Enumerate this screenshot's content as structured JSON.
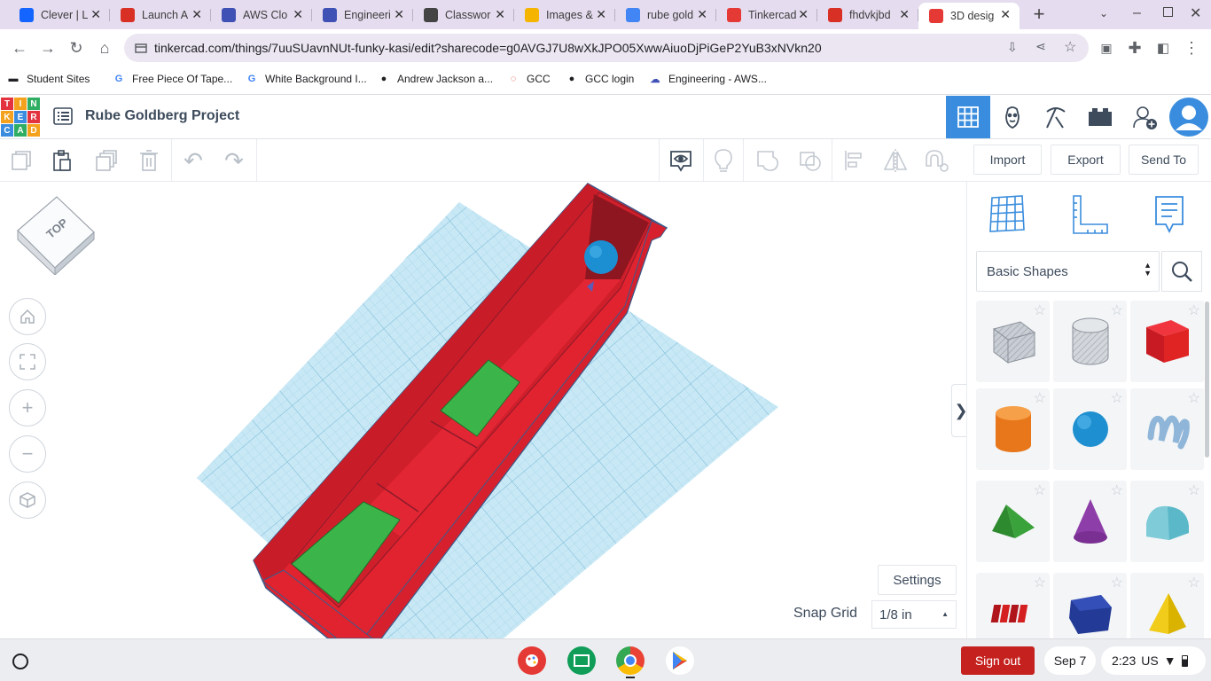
{
  "browser": {
    "tabs": [
      {
        "label": "Clever | L",
        "icon": "clever-icon",
        "color": "#1464ff"
      },
      {
        "label": "Launch A",
        "icon": "launch-icon",
        "color": "#d93025"
      },
      {
        "label": "AWS Clo",
        "icon": "aws-cloud-icon",
        "color": "#3f51b5"
      },
      {
        "label": "Engineeri",
        "icon": "aws-cloud-icon",
        "color": "#3f51b5"
      },
      {
        "label": "Classwor",
        "icon": "classroom-icon",
        "color": "#444"
      },
      {
        "label": "Images &",
        "icon": "slides-icon",
        "color": "#f4b400"
      },
      {
        "label": "rube gold",
        "icon": "google-icon",
        "color": "#4285f4"
      },
      {
        "label": "Tinkercad",
        "icon": "tinkercad-icon",
        "color": "#e53935"
      },
      {
        "label": "fhdvkjbd",
        "icon": "gmail-icon",
        "color": "#d93025"
      },
      {
        "label": "3D desig",
        "icon": "tinkercad-icon",
        "color": "#e53935"
      }
    ],
    "new_tab": "+",
    "url": "tinkercad.com/things/7uuSUavnNUt-funky-kasi/edit?sharecode=g0AVGJ7U8wXkJPO05XwwAiuoDjPiGeP2YuB3xNVkn20",
    "bookmarks": [
      {
        "label": "Student Sites",
        "icon": "folder-icon"
      },
      {
        "label": "Free Piece Of Tape...",
        "icon": "google-icon"
      },
      {
        "label": "White Background I...",
        "icon": "google-icon"
      },
      {
        "label": "Andrew Jackson a...",
        "icon": "globe-icon"
      },
      {
        "label": "GCC",
        "icon": "gcc-icon"
      },
      {
        "label": "GCC login",
        "icon": "globe-icon"
      },
      {
        "label": "Engineering - AWS...",
        "icon": "aws-cloud-icon"
      }
    ]
  },
  "tinkercad": {
    "logo_letters": [
      "T",
      "I",
      "N",
      "K",
      "E",
      "R",
      "C",
      "A",
      "D"
    ],
    "project_title": "Rube Goldberg Project",
    "header_buttons": [
      "3d-view-icon",
      "codeblocks-icon",
      "lesson-icon",
      "bricks-icon",
      "add-user-icon",
      "account-avatar"
    ],
    "actions": {
      "import": "Import",
      "export": "Export",
      "send_to": "Send To"
    },
    "view_cube_label": "TOP",
    "settings_label": "Settings",
    "snap_grid": {
      "label": "Snap Grid",
      "value": "1/8 in"
    },
    "shape_category": "Basic Shapes",
    "shapes": [
      {
        "name": "box-hole",
        "color": "#b9bfc8"
      },
      {
        "name": "cylinder-hole",
        "color": "#c9cdd3"
      },
      {
        "name": "box",
        "color": "#e02323"
      },
      {
        "name": "cylinder",
        "color": "#f0821e"
      },
      {
        "name": "sphere",
        "color": "#1e8fd0"
      },
      {
        "name": "scribble",
        "color": "#8fb6d8"
      },
      {
        "name": "roof",
        "color": "#3aa23a"
      },
      {
        "name": "cone",
        "color": "#8e3ea8"
      },
      {
        "name": "round-roof",
        "color": "#5bb8c8"
      },
      {
        "name": "text",
        "color": "#d42020"
      },
      {
        "name": "polygon",
        "color": "#233a96"
      },
      {
        "name": "pyramid",
        "color": "#f2cc1a"
      }
    ]
  },
  "shelf": {
    "sign_out": "Sign out",
    "date": "Sep 7",
    "time": "2:23",
    "locale": "US"
  }
}
